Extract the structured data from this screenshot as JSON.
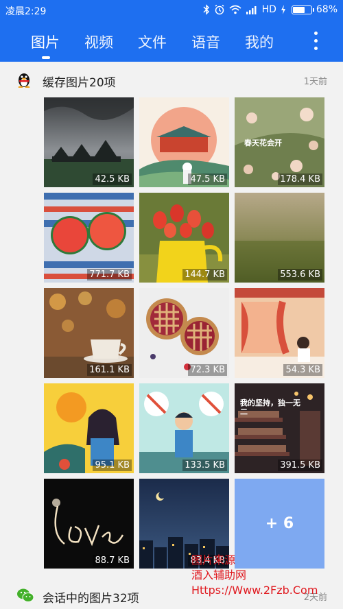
{
  "status_bar": {
    "time": "凌晨2:29",
    "network": "HD",
    "battery_text": "68%",
    "battery_level": 0.68
  },
  "tabs": [
    {
      "label": "图片",
      "active": true
    },
    {
      "label": "视频",
      "active": false
    },
    {
      "label": "文件",
      "active": false
    },
    {
      "label": "语音",
      "active": false
    },
    {
      "label": "我的",
      "active": false
    }
  ],
  "section1": {
    "title": "缓存图片20项",
    "time": "1天前",
    "icon": "qq-penguin-icon"
  },
  "section2": {
    "title": "会话中的图片32项",
    "time": "2天前",
    "icon": "wechat-icon"
  },
  "images": [
    {
      "size": "42.5 KB",
      "subject": "stormy-houses"
    },
    {
      "size": "47.5 KB",
      "subject": "palace-illustration"
    },
    {
      "size": "178.4 KB",
      "subject": "spring-flowers",
      "caption": "春天花会开"
    },
    {
      "size": "771.7 KB",
      "subject": "watermelon"
    },
    {
      "size": "144.7 KB",
      "subject": "tulips"
    },
    {
      "size": "553.6 KB",
      "subject": "grass-field"
    },
    {
      "size": "161.1 KB",
      "subject": "coffee-bokeh"
    },
    {
      "size": "72.3 KB",
      "subject": "pies"
    },
    {
      "size": "54.3 KB",
      "subject": "girl-window"
    },
    {
      "size": "95.1 KB",
      "subject": "girl-sun"
    },
    {
      "size": "133.5 KB",
      "subject": "boy-food"
    },
    {
      "size": "391.5 KB",
      "subject": "library",
      "caption": "我的坚持，独一无二"
    },
    {
      "size": "88.7 KB",
      "subject": "sparkler-love",
      "caption": "love"
    },
    {
      "size": "83.4 KB",
      "subject": "night-city"
    }
  ],
  "more_count": "+ 6",
  "watermark": {
    "line1": "图片来源",
    "line2": "酒入辅助网",
    "line3": "Https://Www.2Fzb.Com"
  }
}
